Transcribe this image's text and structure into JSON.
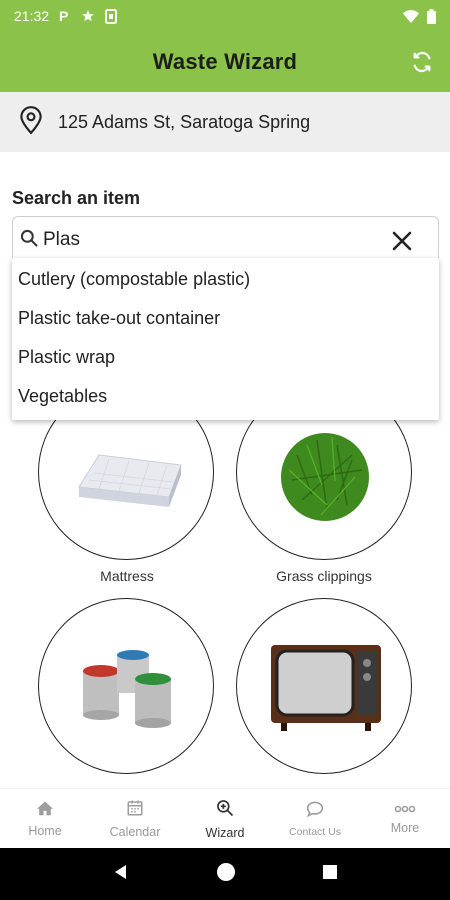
{
  "status": {
    "time": "21:32"
  },
  "appbar": {
    "title": "Waste Wizard"
  },
  "address": {
    "text": "125 Adams St, Saratoga Spring"
  },
  "search": {
    "label": "Search an item",
    "query": "Plas"
  },
  "suggestions": [
    "Cutlery (compostable plastic)",
    "Plastic take-out container",
    "Plastic wrap",
    "Vegetables"
  ],
  "items": [
    {
      "label": "Mattress",
      "icon": "mattress-image"
    },
    {
      "label": "Grass clippings",
      "icon": "grass-image"
    },
    {
      "label": "",
      "icon": "paint-cans-image"
    },
    {
      "label": "",
      "icon": "tv-image"
    }
  ],
  "nav": {
    "items": [
      {
        "label": "Home",
        "icon": "home-icon"
      },
      {
        "label": "Calendar",
        "icon": "calendar-icon"
      },
      {
        "label": "Wizard",
        "icon": "wizard-icon",
        "active": true
      },
      {
        "label": "Contact Us",
        "icon": "chat-icon"
      },
      {
        "label": "More",
        "icon": "more-icon"
      }
    ]
  },
  "colors": {
    "accent": "#8bc34a"
  }
}
